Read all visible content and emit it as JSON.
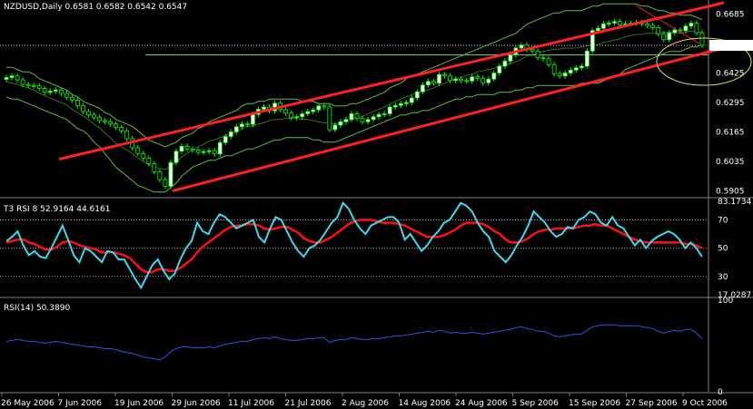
{
  "header": {
    "main_title": "NZDUSD,Daily  0.6581 0.6582 0.6542 0.6547",
    "t3_title": "T3 RSI  8 52.9164 44.6161",
    "rsi_title": "RSI(14) 50.3890"
  },
  "colors": {
    "background": "#000000",
    "bull_candle": "#ffffff",
    "bear_candle": "#000000",
    "candle_wick": "#00ff00",
    "bollinger": "#66bb44",
    "trend_channel": "#ff2020",
    "cyan_line": "#40d8f0",
    "red_line": "#ff1010",
    "rsi_line": "#3050e8",
    "ellipse": "#e8e050",
    "horizontal_line": "#66cc44",
    "separator": "#808080"
  },
  "chart_data": [
    {
      "type": "candlestick",
      "title": "NZDUSD,Daily  0.6581 0.6582 0.6542 0.6547",
      "y_ticks": [
        "0.6685",
        "0.6425",
        "0.6295",
        "0.6165",
        "0.6035",
        "0.5905"
      ],
      "y_tick_values": [
        0.6685,
        0.6425,
        0.6295,
        0.6165,
        0.6035,
        0.5905
      ],
      "ylim": [
        0.5895,
        0.6735
      ],
      "current_price": 0.6547,
      "current_price_label": "0.6547",
      "close_series": [
        0.6405,
        0.6412,
        0.6395,
        0.6375,
        0.637,
        0.6368,
        0.6357,
        0.634,
        0.6345,
        0.635,
        0.6335,
        0.6318,
        0.6305,
        0.628,
        0.6255,
        0.624,
        0.623,
        0.6215,
        0.621,
        0.62,
        0.6185,
        0.617,
        0.6135,
        0.6095,
        0.607,
        0.605,
        0.6025,
        0.599,
        0.5955,
        0.5925,
        0.603,
        0.608,
        0.6102,
        0.609,
        0.6085,
        0.6075,
        0.6078,
        0.6082,
        0.6068,
        0.6118,
        0.6145,
        0.6165,
        0.6188,
        0.62,
        0.6198,
        0.6242,
        0.6265,
        0.6275,
        0.6258,
        0.6292,
        0.6263,
        0.6248,
        0.6228,
        0.6232,
        0.6245,
        0.6255,
        0.6262,
        0.628,
        0.6275,
        0.6175,
        0.6195,
        0.621,
        0.622,
        0.6245,
        0.6225,
        0.621,
        0.622,
        0.6232,
        0.6242,
        0.6245,
        0.6275,
        0.6282,
        0.629,
        0.6295,
        0.6315,
        0.6342,
        0.6372,
        0.6388,
        0.638,
        0.6418,
        0.6412,
        0.6392,
        0.6398,
        0.6392,
        0.639,
        0.6408,
        0.6402,
        0.6382,
        0.6398,
        0.6425,
        0.6455,
        0.6478,
        0.6505,
        0.6535,
        0.6548,
        0.6528,
        0.6522,
        0.6492,
        0.6488,
        0.6462,
        0.6422,
        0.6412,
        0.6425,
        0.6438,
        0.6448,
        0.6455,
        0.6522,
        0.6612,
        0.6622,
        0.6642,
        0.6645,
        0.6652,
        0.6638,
        0.6642,
        0.6645,
        0.6648,
        0.6642,
        0.6635,
        0.6625,
        0.6598,
        0.6572,
        0.6602,
        0.6615,
        0.6612,
        0.6632,
        0.6645,
        0.6602,
        0.6547
      ],
      "bollinger": {
        "upper": [
          0.645,
          0.645,
          0.644,
          0.643,
          0.643,
          0.642,
          0.64,
          0.639,
          0.638,
          0.637,
          0.636,
          0.635,
          0.633,
          0.632,
          0.63,
          0.629,
          0.628,
          0.627,
          0.625,
          0.624,
          0.622,
          0.621,
          0.62,
          0.619,
          0.617,
          0.615,
          0.613,
          0.612,
          0.611,
          0.61,
          0.611,
          0.612,
          0.614,
          0.615,
          0.616,
          0.618,
          0.619,
          0.621,
          0.622,
          0.623,
          0.624,
          0.625,
          0.626,
          0.628,
          0.629,
          0.629,
          0.63,
          0.63,
          0.631,
          0.631,
          0.631,
          0.631,
          0.631,
          0.631,
          0.63,
          0.63,
          0.63,
          0.629,
          0.629,
          0.629,
          0.628,
          0.628,
          0.628,
          0.629,
          0.629,
          0.63,
          0.631,
          0.632,
          0.633,
          0.634,
          0.636,
          0.637,
          0.638,
          0.64,
          0.641,
          0.642,
          0.643,
          0.644,
          0.645,
          0.646,
          0.647,
          0.648,
          0.649,
          0.65,
          0.651,
          0.652,
          0.653,
          0.654,
          0.655,
          0.656,
          0.657,
          0.658,
          0.659,
          0.66,
          0.662,
          0.664,
          0.665,
          0.666,
          0.667,
          0.668,
          0.669,
          0.669,
          0.67,
          0.67,
          0.67,
          0.67,
          0.671,
          0.672,
          0.672,
          0.673,
          0.673,
          0.673,
          0.673,
          0.673,
          0.673,
          0.673,
          0.672,
          0.672,
          0.671,
          0.67,
          0.67,
          0.669,
          0.669,
          0.668,
          0.668,
          0.668,
          0.667,
          0.666
        ],
        "lower": [
          0.632,
          0.631,
          0.631,
          0.63,
          0.629,
          0.628,
          0.627,
          0.626,
          0.625,
          0.624,
          0.623,
          0.622,
          0.62,
          0.618,
          0.617,
          0.615,
          0.612,
          0.61,
          0.607,
          0.604,
          0.601,
          0.599,
          0.597,
          0.595,
          0.593,
          0.592,
          0.591,
          0.59,
          0.59,
          0.59,
          0.592,
          0.594,
          0.597,
          0.599,
          0.601,
          0.602,
          0.603,
          0.604,
          0.604,
          0.605,
          0.606,
          0.606,
          0.607,
          0.608,
          0.609,
          0.609,
          0.61,
          0.611,
          0.612,
          0.613,
          0.613,
          0.614,
          0.614,
          0.614,
          0.614,
          0.614,
          0.613,
          0.613,
          0.612,
          0.612,
          0.612,
          0.613,
          0.614,
          0.615,
          0.616,
          0.617,
          0.618,
          0.619,
          0.62,
          0.621,
          0.622,
          0.623,
          0.624,
          0.624,
          0.625,
          0.625,
          0.626,
          0.626,
          0.627,
          0.628,
          0.629,
          0.63,
          0.631,
          0.631,
          0.632,
          0.632,
          0.633,
          0.633,
          0.633,
          0.633,
          0.634,
          0.634,
          0.634,
          0.635,
          0.635,
          0.636,
          0.636,
          0.637,
          0.637,
          0.637,
          0.637,
          0.637,
          0.637,
          0.637,
          0.637,
          0.638,
          0.638,
          0.638,
          0.638,
          0.639,
          0.64,
          0.641,
          0.642,
          0.644,
          0.645,
          0.646,
          0.647,
          0.648,
          0.649,
          0.65,
          0.651,
          0.652,
          0.652,
          0.652,
          0.653,
          0.654,
          0.654,
          0.655
        ]
      },
      "trend_channel": {
        "upper": [
          [
            0.6045,
            0.6735
          ]
        ],
        "lower": [
          [
            0.5905,
            0.6535
          ]
        ]
      },
      "horizontal_line_value": 0.6505
    },
    {
      "type": "line",
      "title": "T3 RSI  8 52.9164 44.6161",
      "y_ticks": [
        "83.1734",
        "70",
        "50",
        "30",
        "17.0287"
      ],
      "y_tick_values": [
        83.1734,
        70,
        50,
        30,
        17.0287
      ],
      "ylim": [
        17.0287,
        83.1734
      ],
      "series": [
        {
          "values": [
            55,
            58,
            62,
            52,
            45,
            48,
            44,
            43,
            50,
            58,
            66,
            56,
            45,
            40,
            50,
            48,
            44,
            40,
            48,
            47,
            42,
            42,
            35,
            28,
            22,
            30,
            38,
            42,
            34,
            28,
            32,
            42,
            50,
            55,
            68,
            62,
            60,
            68,
            74,
            72,
            68,
            64,
            66,
            68,
            70,
            58,
            54,
            64,
            72,
            70,
            62,
            54,
            48,
            44,
            50,
            52,
            56,
            62,
            68,
            72,
            82,
            78,
            70,
            64,
            60,
            66,
            68,
            70,
            72,
            72,
            68,
            56,
            60,
            54,
            48,
            52,
            58,
            62,
            68,
            70,
            76,
            82,
            80,
            76,
            68,
            62,
            58,
            48,
            44,
            40,
            45,
            52,
            58,
            66,
            76,
            72,
            68,
            62,
            58,
            60,
            65,
            64,
            70,
            72,
            76,
            74,
            68,
            66,
            72,
            66,
            64,
            58,
            52,
            56,
            50,
            55,
            58,
            60,
            62,
            60,
            56,
            50,
            54,
            50,
            44
          ]
        },
        {
          "values": [
            54,
            55,
            56,
            56,
            54,
            53,
            51,
            49,
            49,
            51,
            54,
            55,
            54,
            52,
            51,
            50,
            49,
            47,
            47,
            47,
            46,
            45,
            43,
            39,
            35,
            33,
            33,
            35,
            35,
            34,
            34,
            36,
            39,
            42,
            47,
            51,
            54,
            57,
            60,
            63,
            65,
            66,
            66,
            67,
            67,
            66,
            64,
            63,
            64,
            65,
            65,
            63,
            61,
            57,
            55,
            54,
            54,
            56,
            58,
            61,
            64,
            67,
            69,
            70,
            70,
            70,
            69,
            68,
            68,
            68,
            67,
            66,
            64,
            62,
            60,
            58,
            58,
            58,
            59,
            61,
            63,
            66,
            68,
            68,
            68,
            67,
            65,
            62,
            60,
            56,
            54,
            54,
            55,
            57,
            60,
            62,
            63,
            63,
            64,
            64,
            64,
            64,
            65,
            66,
            66,
            67,
            66,
            66,
            64,
            62,
            60,
            58,
            56,
            55,
            54,
            54,
            54,
            54,
            54,
            54,
            54,
            53,
            53,
            52,
            50
          ]
        }
      ]
    },
    {
      "type": "line",
      "title": "RSI(14) 50.3890",
      "y_ticks": [
        "100",
        "0"
      ],
      "y_tick_values": [
        100,
        0
      ],
      "ylim": [
        0,
        100
      ],
      "series": [
        {
          "values": [
            55,
            56,
            57,
            56,
            55,
            55,
            54,
            53,
            54,
            55,
            54,
            53,
            52,
            51,
            50,
            49,
            49,
            48,
            47,
            47,
            46,
            44,
            43,
            42,
            40,
            38,
            37,
            36,
            35,
            38,
            44,
            47,
            49,
            49,
            48,
            48,
            48,
            49,
            48,
            50,
            52,
            53,
            54,
            55,
            55,
            57,
            58,
            59,
            58,
            60,
            58,
            57,
            56,
            56,
            57,
            58,
            58,
            59,
            59,
            54,
            56,
            57,
            57,
            59,
            58,
            57,
            57,
            58,
            58,
            59,
            60,
            61,
            61,
            62,
            63,
            64,
            65,
            66,
            65,
            67,
            66,
            64,
            65,
            64,
            64,
            65,
            64,
            63,
            64,
            65,
            66,
            67,
            68,
            70,
            71,
            69,
            68,
            66,
            66,
            64,
            61,
            60,
            61,
            62,
            63,
            63,
            67,
            71,
            72,
            73,
            73,
            73,
            72,
            72,
            72,
            72,
            71,
            70,
            69,
            66,
            64,
            66,
            67,
            66,
            68,
            68,
            64,
            58
          ]
        }
      ]
    }
  ],
  "x_axis": {
    "labels": [
      "26 May 2006",
      "7 Jun 2006",
      "19 Jun 2006",
      "29 Jun 2006",
      "11 Jul 2006",
      "21 Jul 2006",
      "2 Aug 2006",
      "14 Aug 2006",
      "24 Aug 2006",
      "5 Sep 2006",
      "15 Sep 2006",
      "27 Sep 2006",
      "9 Oct 2006"
    ]
  }
}
